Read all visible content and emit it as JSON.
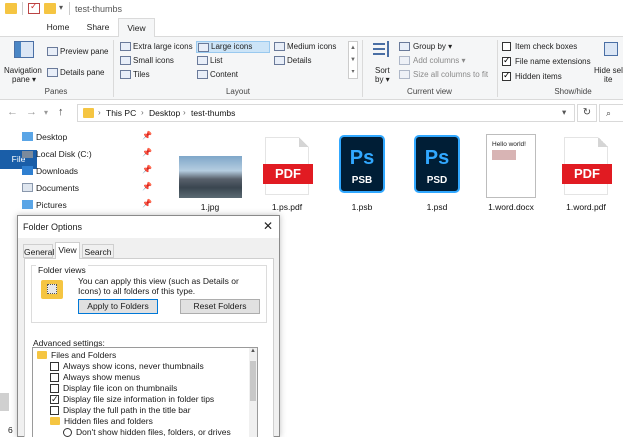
{
  "window": {
    "title": "test-thumbs"
  },
  "tabs": [
    "File",
    "Home",
    "Share",
    "View"
  ],
  "ribbon": {
    "panes": {
      "navigation_pane": "Navigation",
      "navigation_pane2": "pane ▾",
      "preview_pane": "Preview pane",
      "details_pane": "Details pane",
      "label": "Panes"
    },
    "layout": {
      "items": [
        "Extra large icons",
        "Large icons",
        "Medium icons",
        "Small icons",
        "List",
        "Details",
        "Tiles",
        "Content"
      ],
      "selected": "Large icons",
      "label": "Layout"
    },
    "current_view": {
      "sort_by": "Sort",
      "sort_by2": "by ▾",
      "group_by": "Group by ▾",
      "add_columns": "Add columns ▾",
      "size_all": "Size all columns to fit",
      "label": "Current view"
    },
    "show_hide": {
      "item_check_boxes": "Item check boxes",
      "file_name_extensions": "File name extensions",
      "hidden_items": "Hidden items",
      "hide_selected": "Hide sel",
      "hide_selected2": "ite",
      "label": "Show/hide",
      "item_check_boxes_checked": false,
      "file_name_extensions_checked": true,
      "hidden_items_checked": true
    }
  },
  "address": {
    "parts": [
      "This PC",
      "Desktop",
      "test-thumbs"
    ]
  },
  "nav": [
    {
      "label": "Desktop",
      "icon": "folder-icon"
    },
    {
      "label": "Local Disk (C:)",
      "icon": "drive-icon"
    },
    {
      "label": "Downloads",
      "icon": "download-icon"
    },
    {
      "label": "Documents",
      "icon": "documents-icon"
    },
    {
      "label": "Pictures",
      "icon": "pictures-icon"
    }
  ],
  "files": [
    {
      "name": "1.jpg",
      "kind": "photo"
    },
    {
      "name": "1.ps.pdf",
      "kind": "pdf",
      "badge": "PDF"
    },
    {
      "name": "1.psb",
      "kind": "ps",
      "badge": "Ps",
      "ext": "PSB"
    },
    {
      "name": "1.psd",
      "kind": "ps",
      "badge": "Ps",
      "ext": "PSD"
    },
    {
      "name": "1.word.docx",
      "kind": "doc",
      "preview": "Hello world!"
    },
    {
      "name": "1.word.pdf",
      "kind": "pdf",
      "badge": "PDF"
    }
  ],
  "status": {
    "count": "6"
  },
  "dialog": {
    "title": "Folder Options",
    "tabs": [
      "General",
      "View",
      "Search"
    ],
    "folder_views": {
      "legend": "Folder views",
      "text": "You can apply this view (such as Details or Icons) to all folders of this type.",
      "apply_button": "Apply to Folders",
      "reset_button": "Reset Folders"
    },
    "advanced_label": "Advanced settings:",
    "tree": [
      {
        "label": "Files and Folders",
        "type": "folder",
        "checked": false
      },
      {
        "label": "Always show icons, never thumbnails",
        "type": "check",
        "checked": false
      },
      {
        "label": "Always show menus",
        "type": "check",
        "checked": false
      },
      {
        "label": "Display file icon on thumbnails",
        "type": "check",
        "checked": false
      },
      {
        "label": "Display file size information in folder tips",
        "type": "check",
        "checked": true
      },
      {
        "label": "Display the full path in the title bar",
        "type": "check",
        "checked": false
      },
      {
        "label": "Hidden files and folders",
        "type": "folder",
        "checked": false
      },
      {
        "label": "Don't show hidden files, folders, or drives",
        "type": "radio",
        "checked": false
      }
    ]
  }
}
